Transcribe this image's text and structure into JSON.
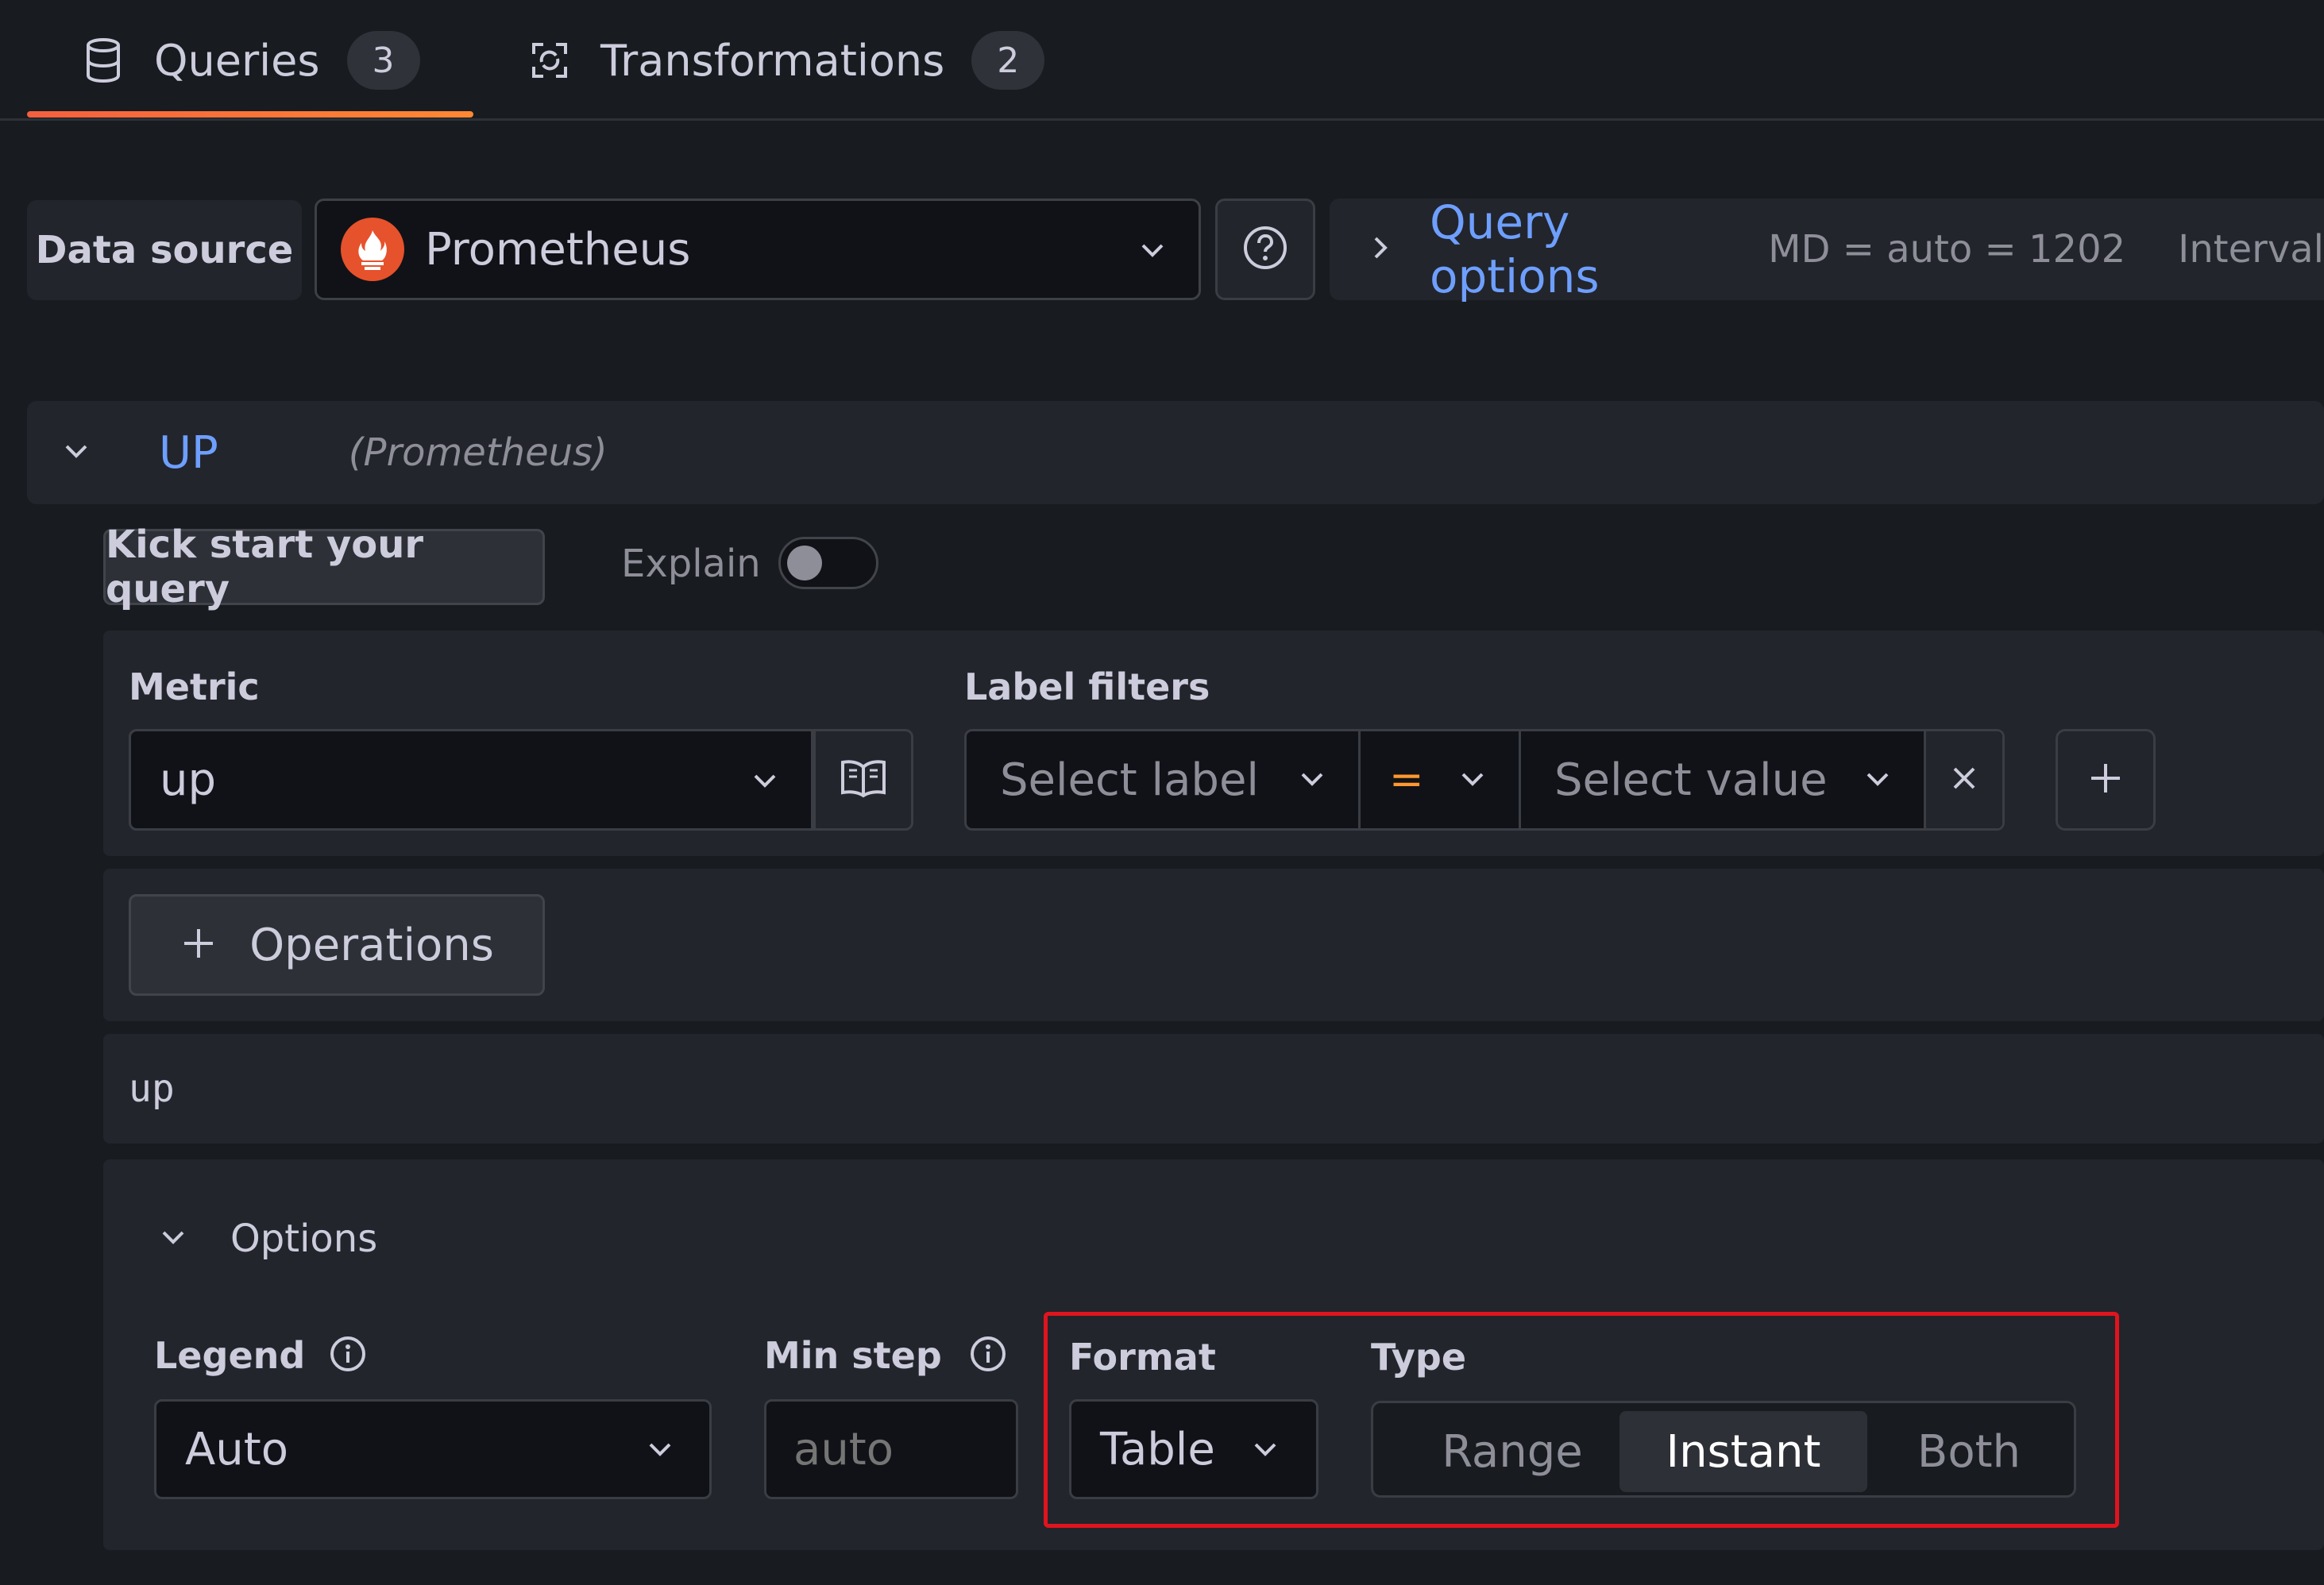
{
  "tabs": [
    {
      "label": "Queries",
      "count": "3",
      "icon": "database-icon",
      "active": true
    },
    {
      "label": "Transformations",
      "count": "2",
      "icon": "transform-icon",
      "active": false
    }
  ],
  "datasource": {
    "label": "Data source",
    "selected": "Prometheus",
    "query_options_label": "Query options",
    "md_info": "MD = auto = 1202",
    "interval_info": "Interval"
  },
  "query": {
    "name": "UP",
    "source": "(Prometheus)",
    "kickstart_label": "Kick start your query",
    "explain_label": "Explain",
    "explain_enabled": false
  },
  "builder": {
    "metric_label": "Metric",
    "metric_value": "up",
    "label_filters_label": "Label filters",
    "select_label_placeholder": "Select label",
    "operator": "=",
    "select_value_placeholder": "Select value",
    "operations_label": "Operations",
    "preview": "up"
  },
  "options": {
    "section_label": "Options",
    "legend_label": "Legend",
    "legend_value": "Auto",
    "min_step_label": "Min step",
    "min_step_placeholder": "auto",
    "format_label": "Format",
    "format_value": "Table",
    "type_label": "Type",
    "type_options": [
      "Range",
      "Instant",
      "Both"
    ],
    "type_selected": "Instant"
  },
  "colors": {
    "accent_link": "#6e9fff",
    "tab_underline": "#f55f3e",
    "highlight": "#e0141e",
    "prometheus": "#e6522c",
    "operator": "#ff9830"
  }
}
